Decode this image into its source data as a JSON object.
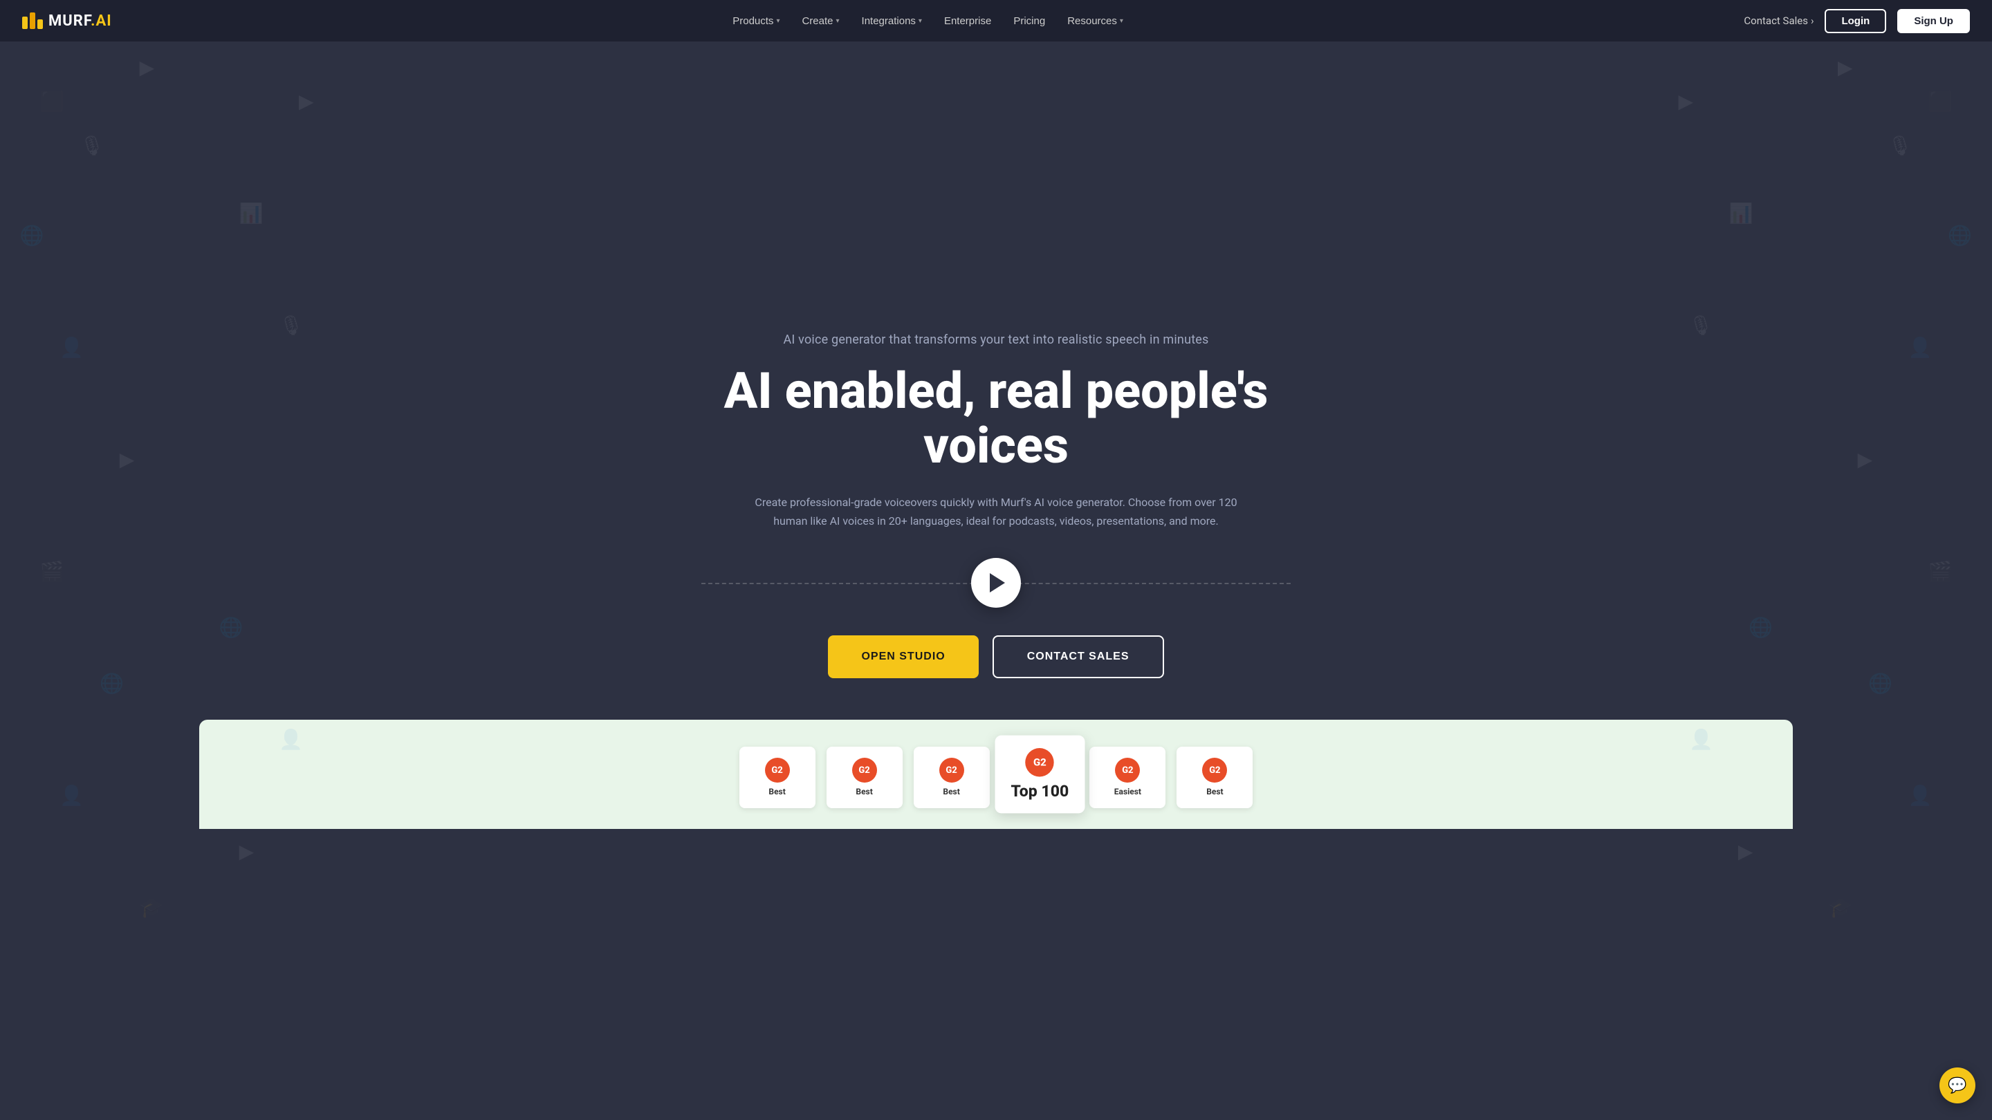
{
  "brand": {
    "name": "MURF.AI",
    "logo_text": "murf",
    "logo_suffix": ".ai"
  },
  "nav": {
    "links": [
      {
        "label": "Products",
        "has_dropdown": true
      },
      {
        "label": "Create",
        "has_dropdown": true
      },
      {
        "label": "Integrations",
        "has_dropdown": true
      },
      {
        "label": "Enterprise",
        "has_dropdown": false
      },
      {
        "label": "Pricing",
        "has_dropdown": false
      },
      {
        "label": "Resources",
        "has_dropdown": true
      }
    ],
    "contact_sales": "Contact Sales",
    "login": "Login",
    "signup": "Sign Up"
  },
  "hero": {
    "subtitle": "AI voice generator that transforms your text into realistic speech in minutes",
    "title": "AI enabled, real people's voices",
    "description": "Create professional-grade voiceovers quickly with Murf's AI voice generator. Choose from over 120 human like AI voices in 20+ languages, ideal for podcasts, videos, presentations, and more.",
    "cta_primary": "OPEN STUDIO",
    "cta_secondary": "CONTACT SALES"
  },
  "awards": [
    {
      "label": "Best",
      "featured": false
    },
    {
      "label": "Best",
      "featured": false
    },
    {
      "label": "Best",
      "featured": false
    },
    {
      "label": "Top 100",
      "featured": true
    },
    {
      "label": "Easiest",
      "featured": false
    },
    {
      "label": "",
      "featured": false
    }
  ],
  "colors": {
    "accent": "#f5c518",
    "background": "#2d3142",
    "nav_bg": "#1e2130",
    "text_muted": "#a0a8c0",
    "white": "#ffffff"
  }
}
